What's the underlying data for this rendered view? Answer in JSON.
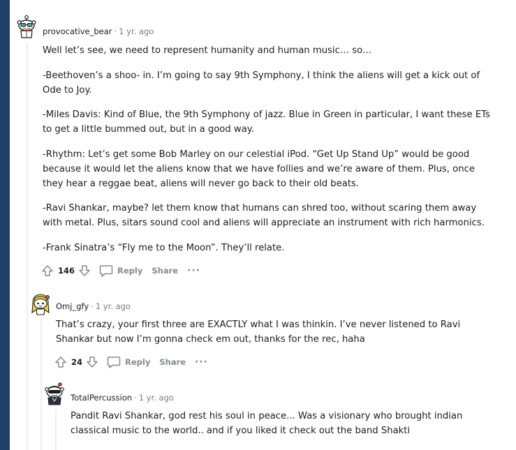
{
  "comments": [
    {
      "username": "provocative_bear",
      "separator": "·",
      "time": "1 yr. ago",
      "paragraphs": [
        "Well let’s see, we need to represent humanity and human music… so…",
        "-Beethoven’s a shoo- in. I’m going to say 9th Symphony, I think the aliens will get a kick out of Ode to Joy.",
        "-Miles Davis: Kind of Blue, the 9th Symphony of jazz. Blue in Green in particular, I want these ETs to get a little bummed out, but in a good way.",
        "-Rhythm: Let’s get some Bob Marley on our celestial iPod. “Get Up Stand Up” would be good because it would let the aliens know that we have follies and we’re aware of them. Plus, once they hear a reggae beat, aliens will never go back to their old beats.",
        "-Ravi Shankar, maybe? let them know that humans can shred too, without scaring them away with metal. Plus, sitars sound cool and aliens will appreciate an instrument with rich harmonics.",
        "-Frank Sinatra’s “Fly me to the Moon”. They’ll relate."
      ],
      "score": "146",
      "reply_label": "Reply",
      "share_label": "Share",
      "more_label": "···"
    },
    {
      "username": "Omj_gfy",
      "separator": "·",
      "time": "1 yr. ago",
      "paragraphs": [
        "That’s crazy, your first three are EXACTLY what I was thinkin. I’ve never listened to Ravi Shankar but now I’m gonna check em out, thanks for the rec, haha"
      ],
      "score": "24",
      "reply_label": "Reply",
      "share_label": "Share",
      "more_label": "···"
    },
    {
      "username": "TotalPercussion",
      "separator": "·",
      "time": "1 yr. ago",
      "paragraphs": [
        "Pandit Ravi Shankar, god rest his soul in peace... Was a visionary who brought indian classical music to the world.. and if you liked it check out the band Shakti"
      ]
    }
  ],
  "colors": {
    "left_bar": "#1e3f66",
    "meta_gray": "#7c7c7c",
    "action_gray": "#878a8c",
    "thread_line": "#edeff1"
  }
}
